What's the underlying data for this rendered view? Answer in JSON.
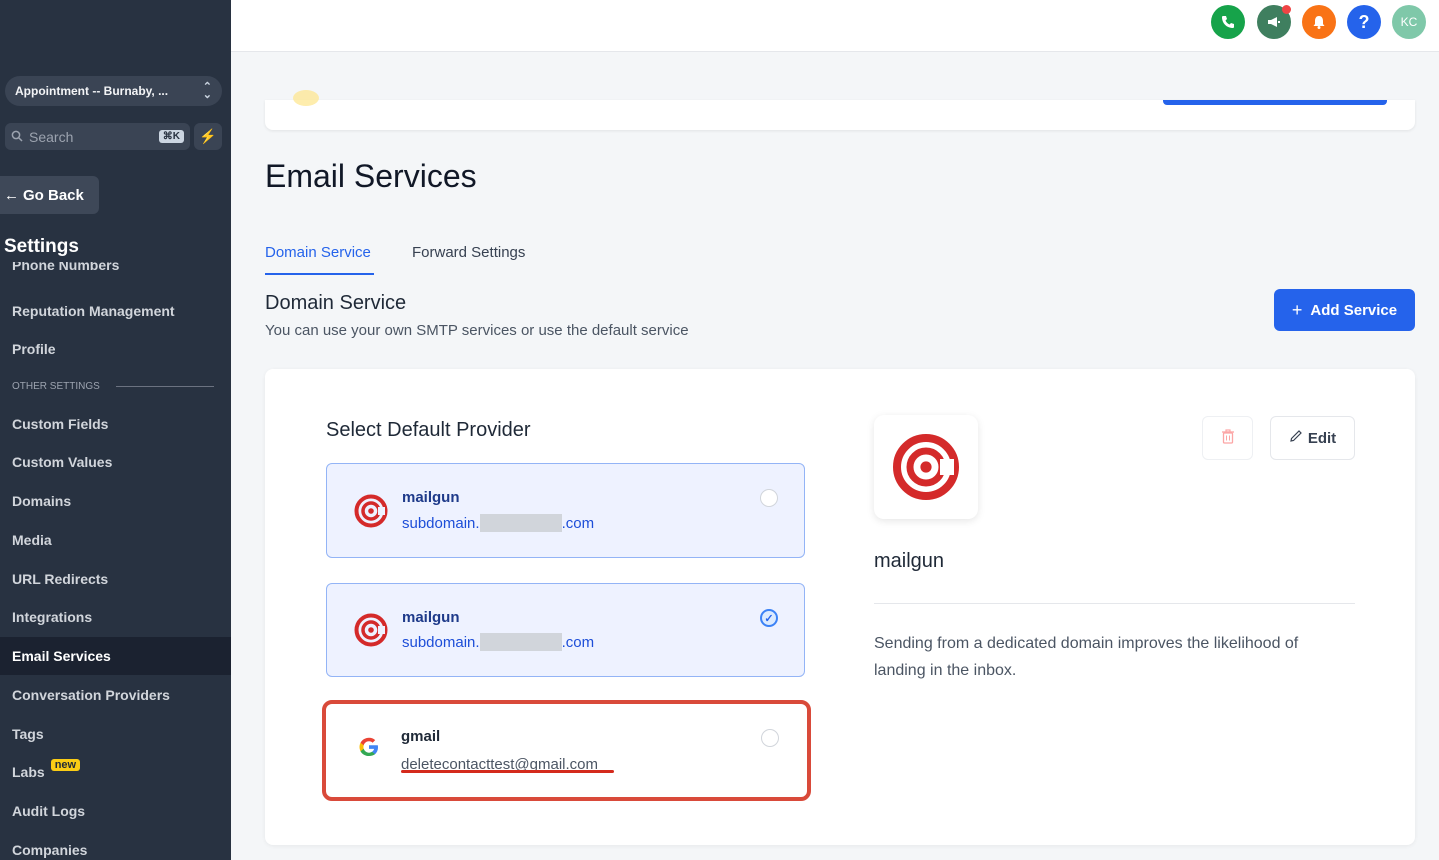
{
  "sidebar": {
    "account": "Appointment -- Burnaby, ...",
    "search_placeholder": "Search",
    "search_shortcut": "⌘K",
    "go_back": "Go Back",
    "settings_title": "Settings",
    "cut_item": "Phone Numbers",
    "items_before": [
      "Reputation Management",
      "Profile"
    ],
    "other_settings_label": "OTHER SETTINGS",
    "items": [
      "Custom Fields",
      "Custom Values",
      "Domains",
      "Media",
      "URL Redirects",
      "Integrations",
      "Email Services",
      "Conversation Providers",
      "Tags",
      "Labs",
      "Audit Logs",
      "Companies"
    ],
    "active_item": "Email Services",
    "labs_badge": "new"
  },
  "topbar": {
    "avatar_initials": "KC",
    "icons": [
      "phone-icon",
      "megaphone-icon",
      "bell-icon",
      "help-icon"
    ]
  },
  "page": {
    "title": "Email Services",
    "tabs": [
      "Domain Service",
      "Forward Settings"
    ],
    "active_tab": "Domain Service",
    "section_title": "Domain Service",
    "section_subtitle": "You can use your own SMTP services or use the default service",
    "add_button": "Add Service"
  },
  "providers": {
    "title": "Select Default Provider",
    "list": [
      {
        "name": "mailgun",
        "domain_prefix": "subdomain.",
        "domain_suffix": ".com",
        "selected": false
      },
      {
        "name": "mailgun",
        "domain_prefix": "subdomain.",
        "domain_suffix": ".com",
        "selected": true
      },
      {
        "name": "gmail",
        "email": "deletecontacttest@gmail.com",
        "selected": false
      }
    ]
  },
  "detail": {
    "name": "mailgun",
    "edit_label": "Edit",
    "description": "Sending from a dedicated domain improves the likelihood of landing in the inbox."
  },
  "colors": {
    "sidebar_bg": "#283241",
    "accent": "#2563eb",
    "highlight_red": "#d94a3a",
    "mailgun_red": "#d42a2a"
  }
}
